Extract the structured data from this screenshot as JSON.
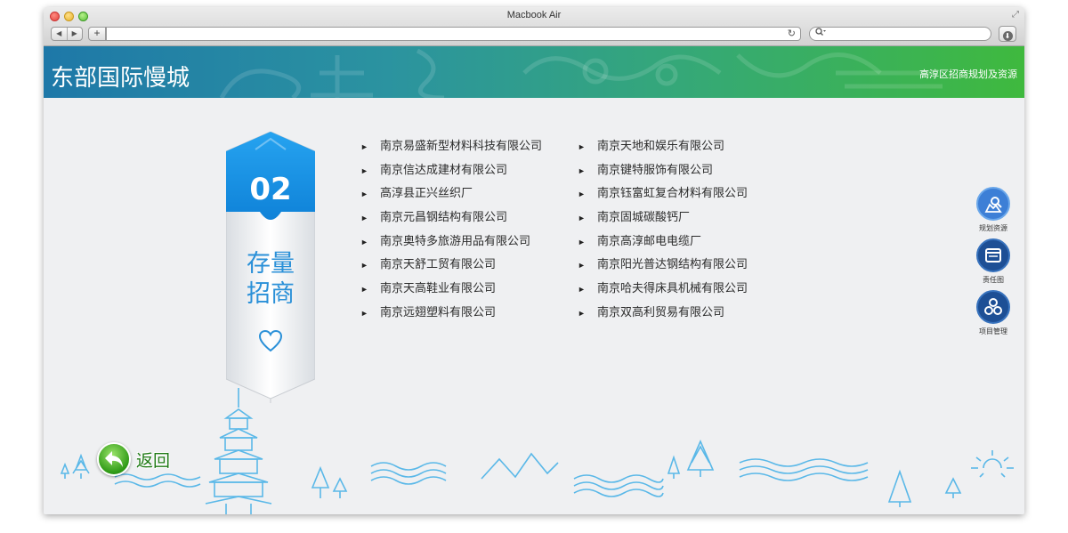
{
  "browser": {
    "window_title": "Macbook Air",
    "nav_back": "◀",
    "nav_forward": "▶",
    "add_tab": "+",
    "reload_icon": "↻",
    "search_icon": "magnifier-icon",
    "download_icon": "download-icon"
  },
  "header": {
    "title": "东部国际慢城",
    "planning_link": "高淳区招商规划及资源",
    "gradient_start": "#1e78a8",
    "gradient_end": "#3fb93e"
  },
  "ribbon": {
    "number": "02",
    "label_line1": "存量",
    "label_line2": "招商",
    "accent_color": "#1c8fe0",
    "icon": "heart-icon"
  },
  "companies": {
    "left": [
      "南京易盛新型材料科技有限公司",
      "南京信达成建材有限公司",
      "高淳县正兴丝织厂",
      "南京元昌钢结构有限公司",
      "南京奥特多旅游用品有限公司",
      "南京天舒工贸有限公司",
      "南京天高鞋业有限公司",
      "南京远翅塑料有限公司"
    ],
    "right": [
      "南京天地和娱乐有限公司",
      "南京键特服饰有限公司",
      "南京钰富虹复合材料有限公司",
      "南京固城碳酸钙厂",
      "南京高淳邮电电缆厂",
      "南京阳光普达钢结构有限公司",
      "南京哈夫得床具机械有限公司",
      "南京双高利贸易有限公司"
    ],
    "bullet": "►"
  },
  "side_tools": [
    {
      "label": "规划资源",
      "icon": "map-person-icon"
    },
    {
      "label": "责任图",
      "icon": "window-icon"
    },
    {
      "label": "项目管理",
      "icon": "network-icon"
    }
  ],
  "back_button": {
    "label": "返回",
    "icon": "back-arrow-icon"
  },
  "scenery_color": "#5ab8e8"
}
